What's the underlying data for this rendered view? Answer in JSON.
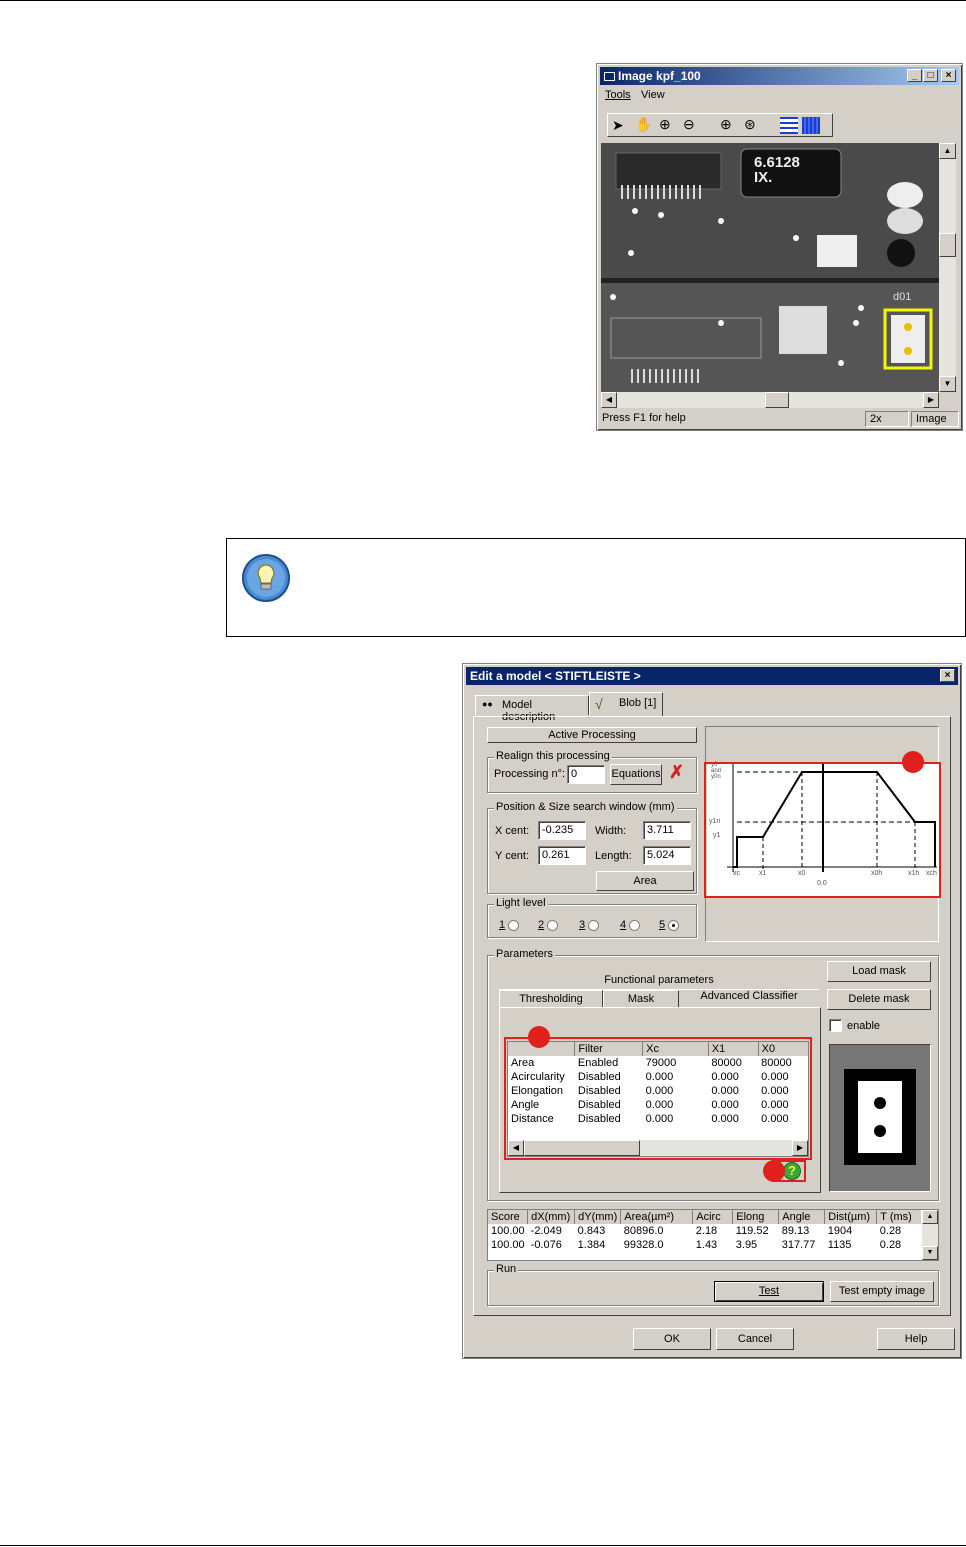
{
  "image_window": {
    "title": "Image kpf_100",
    "menu": [
      "Tools",
      "View"
    ],
    "status_help": "Press F1 for help",
    "status_zoom": "2x",
    "status_mode": "Image",
    "pcb_chip_label": "6.6128\nIX.",
    "pcb_label": "d01"
  },
  "tip_box": {
    "icon": "lightbulb-icon"
  },
  "dialog": {
    "title": "Edit a model < STIFTLEISTE >",
    "tabs": [
      "Model description",
      "Blob [1]"
    ],
    "active_processing": "Active Processing",
    "realign_label": "Realign this processing",
    "processing_label": "Processing n°:",
    "processing_value": "0",
    "equations_btn": "Equations",
    "position_group": "Position & Size search window (mm)",
    "xcent_label": "X cent:",
    "xcent_value": "-0.235",
    "width_label": "Width:",
    "width_value": "3.711",
    "ycent_label": "Y cent:",
    "ycent_value": "0.261",
    "length_label": "Length:",
    "length_value": "5.024",
    "area_btn": "Area",
    "light_level_label": "Light level",
    "light_levels": [
      "1",
      "2",
      "3",
      "4",
      "5"
    ],
    "light_selected": "5",
    "graph_labels": {
      "y0": "y0\nand\ny0n",
      "y1n": "y1n",
      "y1": "y1",
      "xc": "xc",
      "x1": "x1",
      "x0": "x0",
      "zero": "0.0",
      "x0h": "x0h",
      "x1h": "x1h",
      "xch": "xch"
    },
    "parameters_label": "Parameters",
    "functional_tab": "Functional parameters",
    "sub_tabs": [
      "Thresholding",
      "Mask",
      "Advanced Classifier"
    ],
    "load_mask_btn": "Load mask",
    "delete_mask_btn": "Delete mask",
    "enable_label": "enable",
    "classifier_table": {
      "headers": [
        "",
        "Filter",
        "Xc",
        "X1",
        "X0"
      ],
      "rows": [
        [
          "Area",
          "Enabled",
          "79000",
          "80000",
          "80000"
        ],
        [
          "Acircularity",
          "Disabled",
          "0.000",
          "0.000",
          "0.000"
        ],
        [
          "Elongation",
          "Disabled",
          "0.000",
          "0.000",
          "0.000"
        ],
        [
          "Angle",
          "Disabled",
          "0.000",
          "0.000",
          "0.000"
        ],
        [
          "Distance",
          "Disabled",
          "0.000",
          "0.000",
          "0.000"
        ]
      ]
    },
    "results_table": {
      "headers": [
        "Score",
        "dX(mm)",
        "dY(mm)",
        "Area(µm²)",
        "Acirc",
        "Elong",
        "Angle",
        "Dist(µm)",
        "T (ms)"
      ],
      "rows": [
        [
          "100.00",
          "-2.049",
          "0.843",
          "80896.0",
          "2.18",
          "119.52",
          "89.13",
          "1904",
          "0.28"
        ],
        [
          "100.00",
          "-0.076",
          "1.384",
          "99328.0",
          "1.43",
          "3.95",
          "317.77",
          "1135",
          "0.28"
        ]
      ]
    },
    "run_label": "Run",
    "test_btn": "Test",
    "test_empty_btn": "Test empty image",
    "ok_btn": "OK",
    "cancel_btn": "Cancel",
    "help_btn": "Help"
  },
  "colors": {
    "annotation_red": "#e0201c",
    "highlight_yellow": "#f5f500",
    "title_blue": "#0a246a"
  }
}
